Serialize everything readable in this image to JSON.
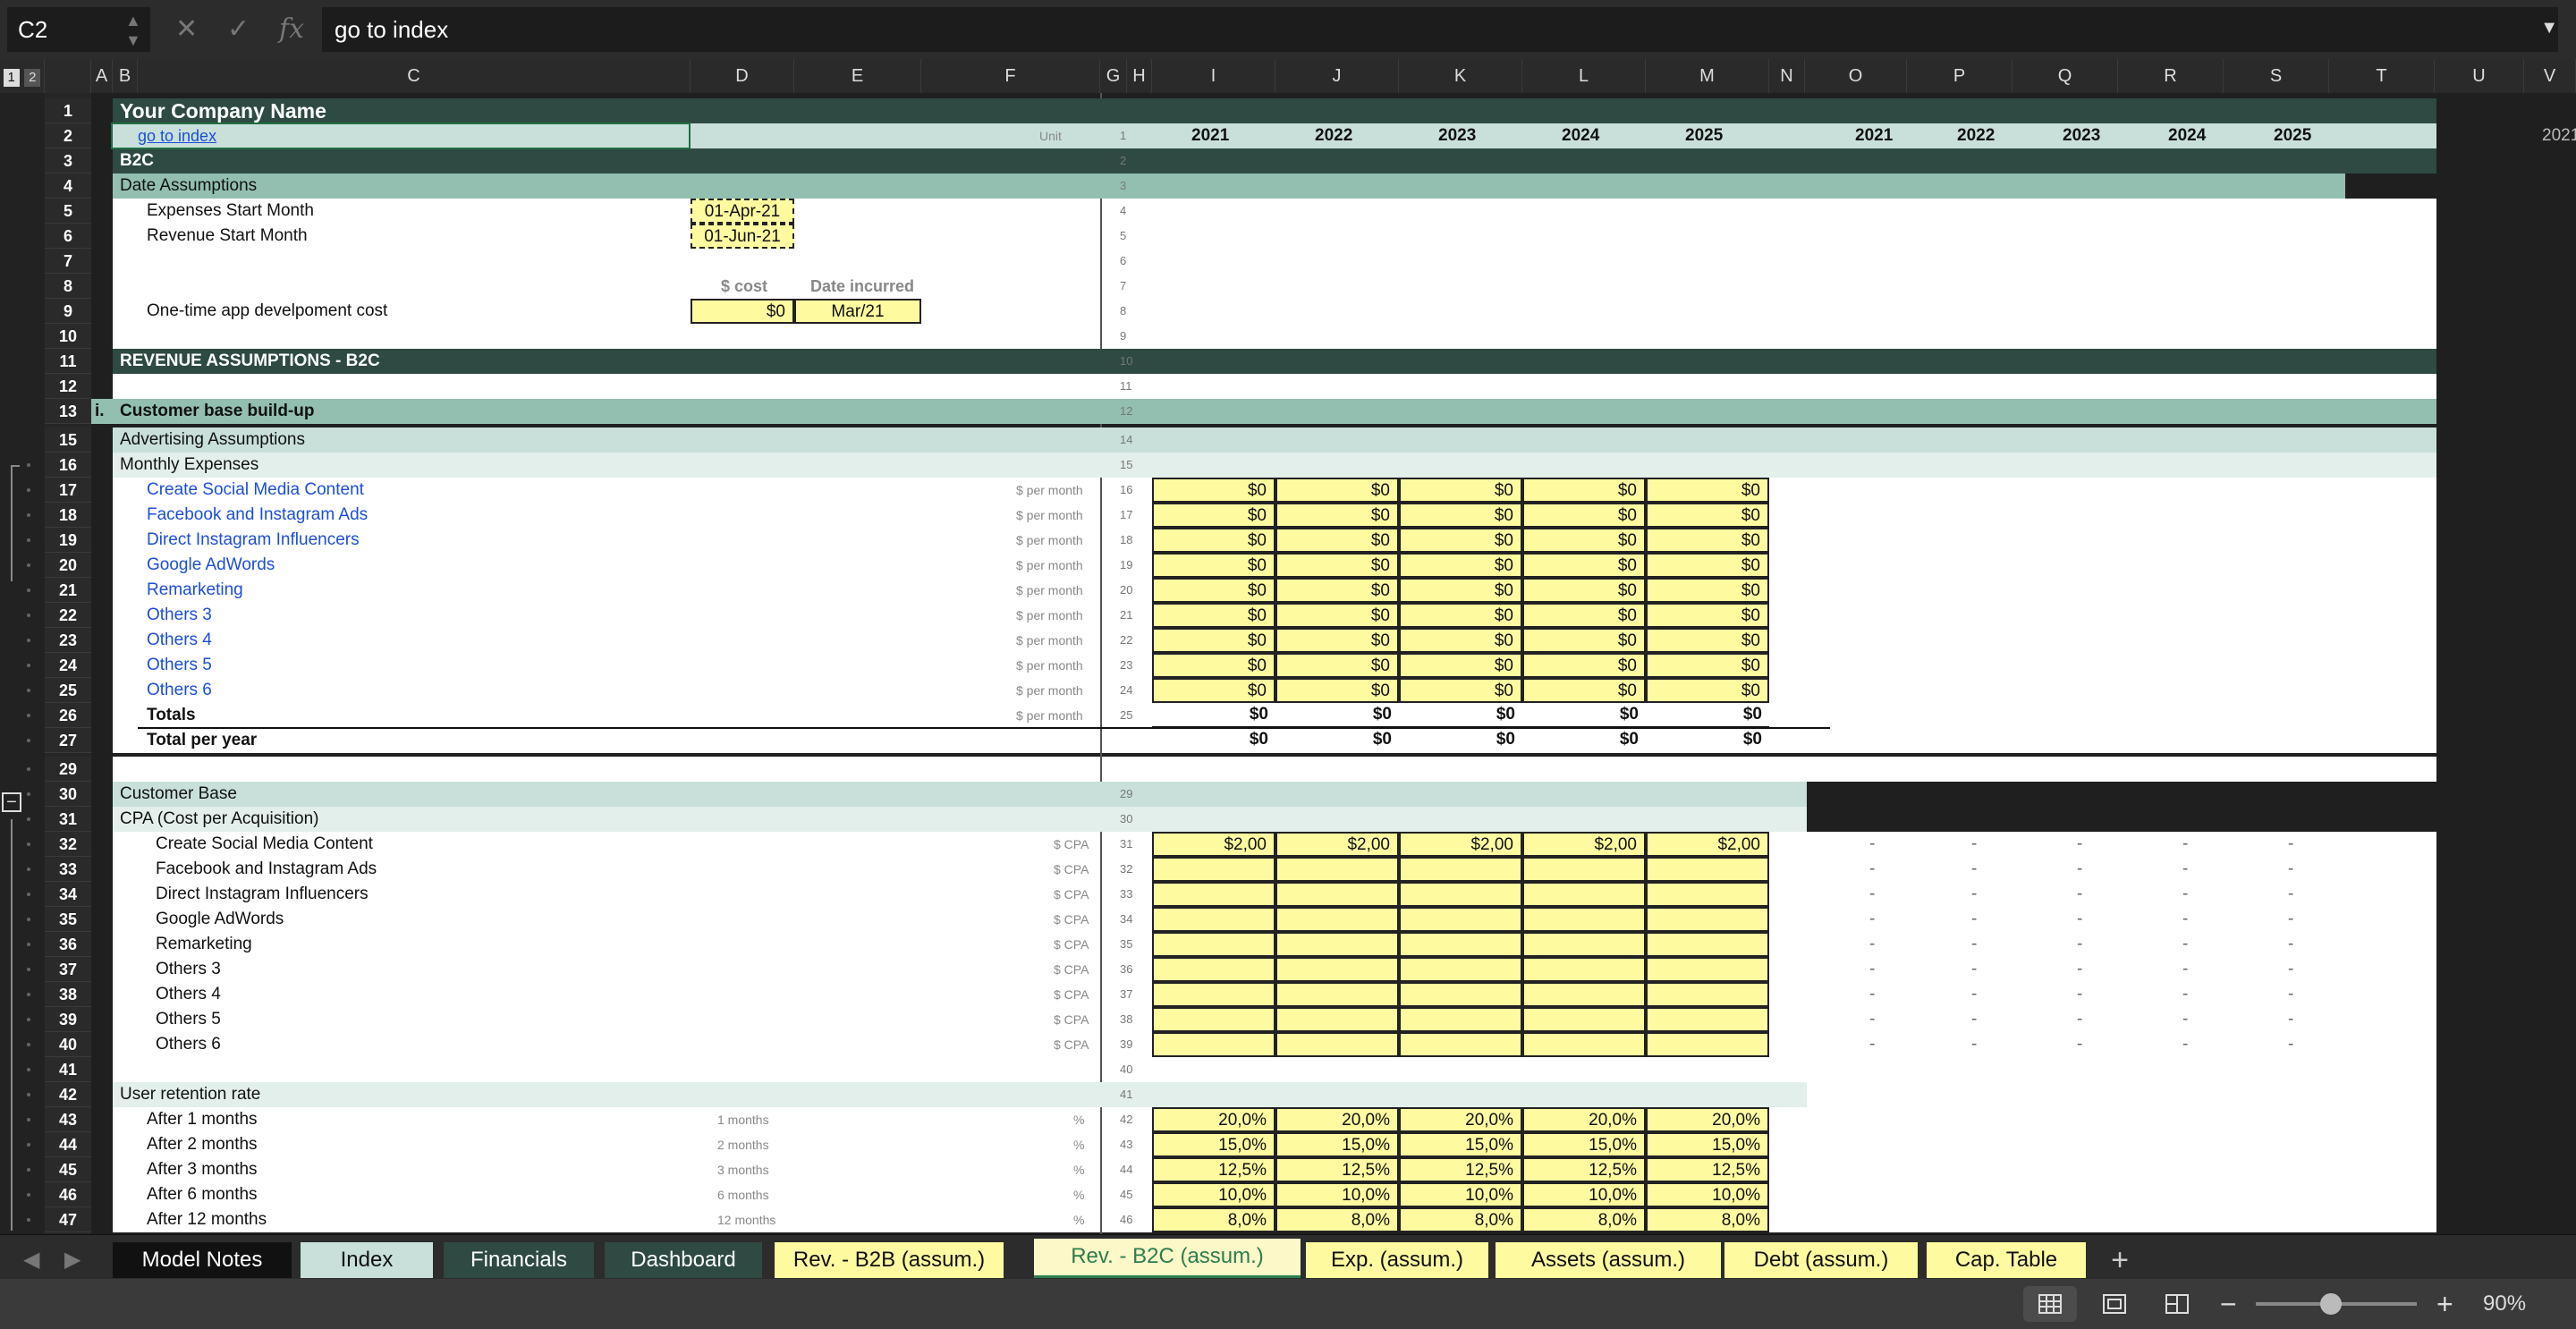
{
  "formula_bar": {
    "name_box": "C2",
    "formula": "go to index",
    "fx": "fx"
  },
  "columns": [
    "A",
    "B",
    "C",
    "D",
    "E",
    "F",
    "G",
    "H",
    "I",
    "J",
    "K",
    "L",
    "M",
    "N",
    "O",
    "P",
    "Q",
    "R",
    "S",
    "T",
    "U",
    "V"
  ],
  "outline_levels": [
    "1",
    "2"
  ],
  "sheet": {
    "company_name": "Your Company Name",
    "link": "go to index",
    "unit_label": "Unit",
    "years_a": [
      "2021",
      "2022",
      "2023",
      "2024",
      "2025"
    ],
    "years_b": [
      "2021",
      "2022",
      "2023",
      "2024",
      "2025"
    ],
    "year_edge": "2021",
    "b2c": "B2C",
    "date_assumptions": "Date Assumptions",
    "expenses_start": "Expenses Start Month",
    "expenses_start_val": "01-Apr-21",
    "revenue_start": "Revenue Start Month",
    "revenue_start_val": "01-Jun-21",
    "cost_hdr": "$ cost",
    "date_hdr": "Date incurred",
    "app_cost": "One-time app develpoment cost",
    "app_cost_val": "$0",
    "app_date_val": "Mar/21",
    "rev_assumptions": "REVENUE ASSUMPTIONS - B2C",
    "roman_i": "i.",
    "customer_build": "Customer base build-up",
    "adv_assumptions": "Advertising Assumptions",
    "monthly_exp": "Monthly Expenses",
    "per_month": "$ per month",
    "expense_rows": [
      "Create Social Media Content",
      "Facebook and Instagram Ads",
      "Direct Instagram Influencers",
      "Google AdWords",
      "Remarketing",
      "Others 3",
      "Others 4",
      "Others 5",
      "Others 6"
    ],
    "expense_value": "$0",
    "totals": "Totals",
    "total_per_year": "Total per year",
    "customer_base": "Customer Base",
    "cpa_title": "CPA (Cost per Acquisition)",
    "cpa_unit": "$ CPA",
    "cpa_rows": [
      "Create Social Media Content",
      "Facebook and Instagram Ads",
      "Direct Instagram Influencers",
      "Google AdWords",
      "Remarketing",
      "Others 3",
      "Others 4",
      "Others 5",
      "Others 6"
    ],
    "cpa_first_value": "$2,00",
    "dash": "-",
    "retention_title": "User retention rate",
    "pct": "%",
    "retention_rows": [
      {
        "label": "After 1 months",
        "months": "1 months",
        "values": [
          "20,0%",
          "20,0%",
          "20,0%",
          "20,0%",
          "20,0%"
        ]
      },
      {
        "label": "After 2 months",
        "months": "2 months",
        "values": [
          "15,0%",
          "15,0%",
          "15,0%",
          "15,0%",
          "15,0%"
        ]
      },
      {
        "label": "After 3 months",
        "months": "3 months",
        "values": [
          "12,5%",
          "12,5%",
          "12,5%",
          "12,5%",
          "12,5%"
        ]
      },
      {
        "label": "After 6 months",
        "months": "6 months",
        "values": [
          "10,0%",
          "10,0%",
          "10,0%",
          "10,0%",
          "10,0%"
        ]
      },
      {
        "label": "After 12 months",
        "months": "12 months",
        "values": [
          "8,0%",
          "8,0%",
          "8,0%",
          "8,0%",
          "8,0%"
        ]
      }
    ]
  },
  "row_numbers": [
    "1",
    "2",
    "3",
    "4",
    "5",
    "6",
    "7",
    "8",
    "9",
    "10",
    "11",
    "12",
    "13",
    "15",
    "16",
    "17",
    "18",
    "19",
    "20",
    "21",
    "22",
    "23",
    "24",
    "25",
    "26",
    "27",
    "29",
    "30",
    "31",
    "32",
    "33",
    "34",
    "35",
    "36",
    "37",
    "38",
    "39",
    "40",
    "41",
    "42",
    "43",
    "44",
    "45",
    "46",
    "47"
  ],
  "index_numbers": [
    "1",
    "2",
    "3",
    "4",
    "5",
    "6",
    "7",
    "8",
    "9",
    "10",
    "11",
    "12",
    "14",
    "15",
    "16",
    "17",
    "18",
    "19",
    "20",
    "21",
    "22",
    "23",
    "24",
    "25",
    "29",
    "30",
    "31",
    "32",
    "33",
    "34",
    "35",
    "36",
    "37",
    "38",
    "39",
    "40",
    "41",
    "42",
    "43",
    "44",
    "45",
    "46"
  ],
  "tabs": [
    {
      "label": "Model Notes",
      "style": "black"
    },
    {
      "label": "Index",
      "style": "mint"
    },
    {
      "label": "Financials",
      "style": "teal"
    },
    {
      "label": "Dashboard",
      "style": "teal"
    },
    {
      "label": "Rev. - B2B (assum.)",
      "style": "yellow"
    },
    {
      "label": "Rev. - B2C (assum.)",
      "style": "active"
    },
    {
      "label": "Exp. (assum.)",
      "style": "yellow"
    },
    {
      "label": "Assets (assum.)",
      "style": "yellow"
    },
    {
      "label": "Debt (assum.)",
      "style": "yellow"
    },
    {
      "label": "Cap. Table",
      "style": "yellow"
    }
  ],
  "add_sheet": "+",
  "zoom": "90%",
  "colors": {
    "dark_teal": "#2e4a42",
    "mid_teal": "#93bfb0",
    "light_teal": "#c9e0da",
    "lighter_teal": "#e2efeb",
    "yellow": "#fefaa0",
    "blue_text": "#1c4ed8"
  }
}
